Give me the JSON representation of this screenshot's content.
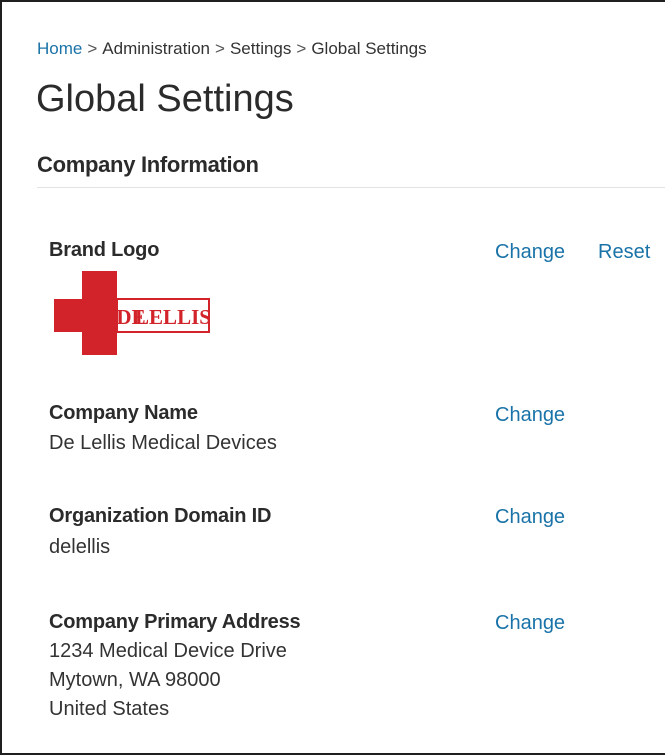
{
  "breadcrumb": {
    "items": [
      "Home",
      "Administration",
      "Settings",
      "Global Settings"
    ],
    "separator": ">"
  },
  "page": {
    "title": "Global Settings"
  },
  "section": {
    "title": "Company Information"
  },
  "fields": {
    "brand_logo": {
      "label": "Brand Logo",
      "logo_text": "DE LELLIS",
      "change_label": "Change",
      "reset_label": "Reset"
    },
    "company_name": {
      "label": "Company Name",
      "value": "De Lellis Medical Devices",
      "change_label": "Change"
    },
    "org_domain_id": {
      "label": "Organization Domain ID",
      "value": "delellis",
      "change_label": "Change"
    },
    "primary_address": {
      "label": "Company Primary Address",
      "lines": [
        "1234 Medical Device Drive",
        "Mytown, WA 98000",
        "United States"
      ],
      "change_label": "Change"
    }
  },
  "colors": {
    "link": "#1a73a8",
    "logo_red": "#d2232a"
  },
  "icons": {
    "logo_cross": "red-cross-icon"
  }
}
